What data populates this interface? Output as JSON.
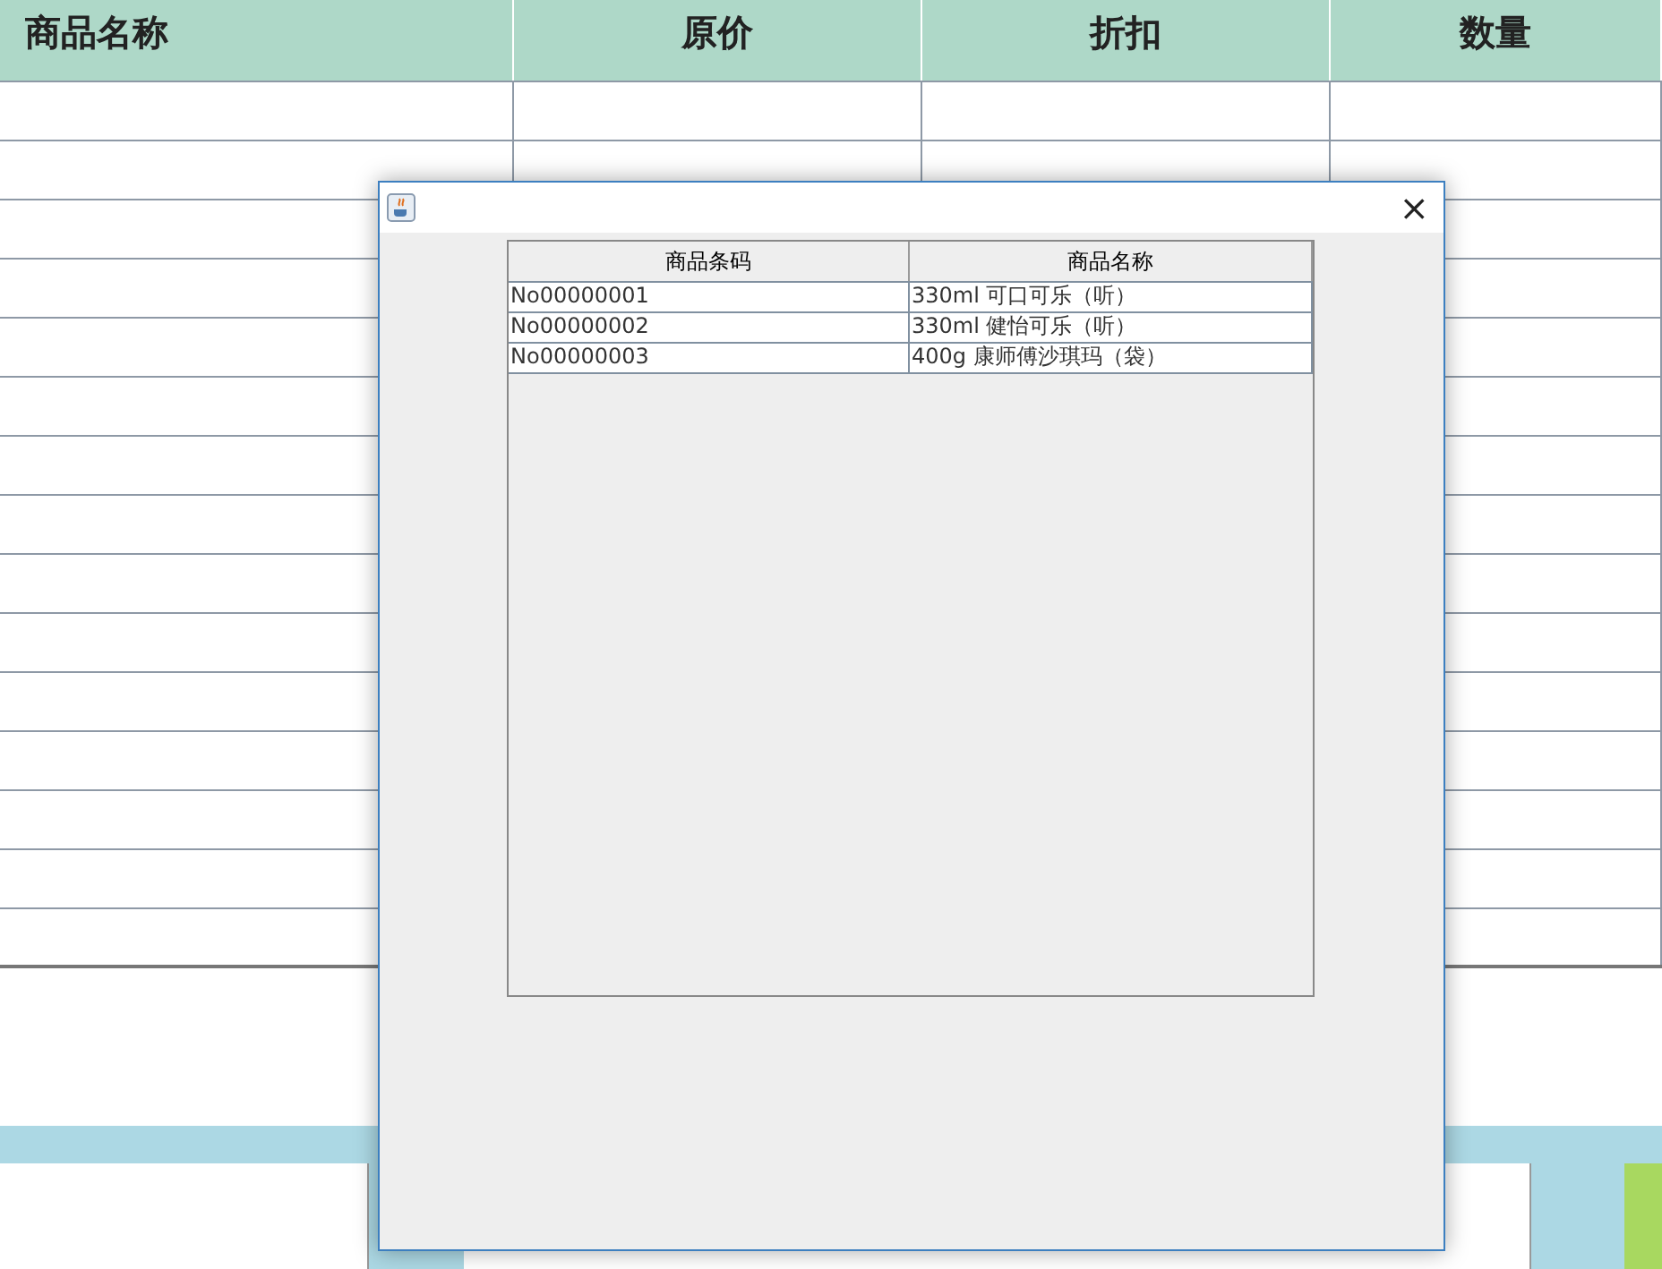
{
  "table": {
    "columns": [
      "商品名称",
      "原价",
      "折扣",
      "数量"
    ]
  },
  "dialog": {
    "close": "×",
    "table": {
      "columns": [
        "商品条码",
        "商品名称"
      ],
      "rows": [
        [
          "No00000001",
          "330ml 可口可乐（听）"
        ],
        [
          "No00000002",
          "330ml 健怡可乐（听）"
        ],
        [
          "No00000003",
          "400g 康师傅沙琪玛（袋）"
        ]
      ]
    }
  }
}
